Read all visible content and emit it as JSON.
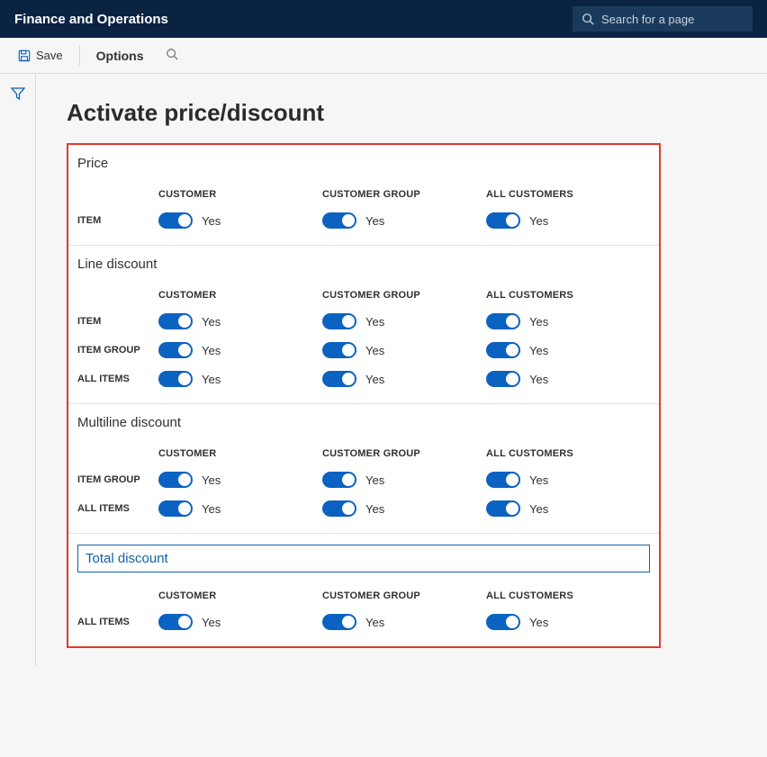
{
  "app_title": "Finance and Operations",
  "search_placeholder": "Search for a page",
  "commands": {
    "save": "Save",
    "options": "Options"
  },
  "page_title": "Activate price/discount",
  "col_headers": [
    "CUSTOMER",
    "CUSTOMER GROUP",
    "ALL CUSTOMERS"
  ],
  "row_labels": {
    "item": "ITEM",
    "item_group": "ITEM GROUP",
    "all_items": "ALL ITEMS"
  },
  "toggle_value": "Yes",
  "sections": {
    "price": {
      "title": "Price"
    },
    "line_discount": {
      "title": "Line discount"
    },
    "multiline_discount": {
      "title": "Multiline discount"
    },
    "total_discount": {
      "title": "Total discount"
    }
  }
}
